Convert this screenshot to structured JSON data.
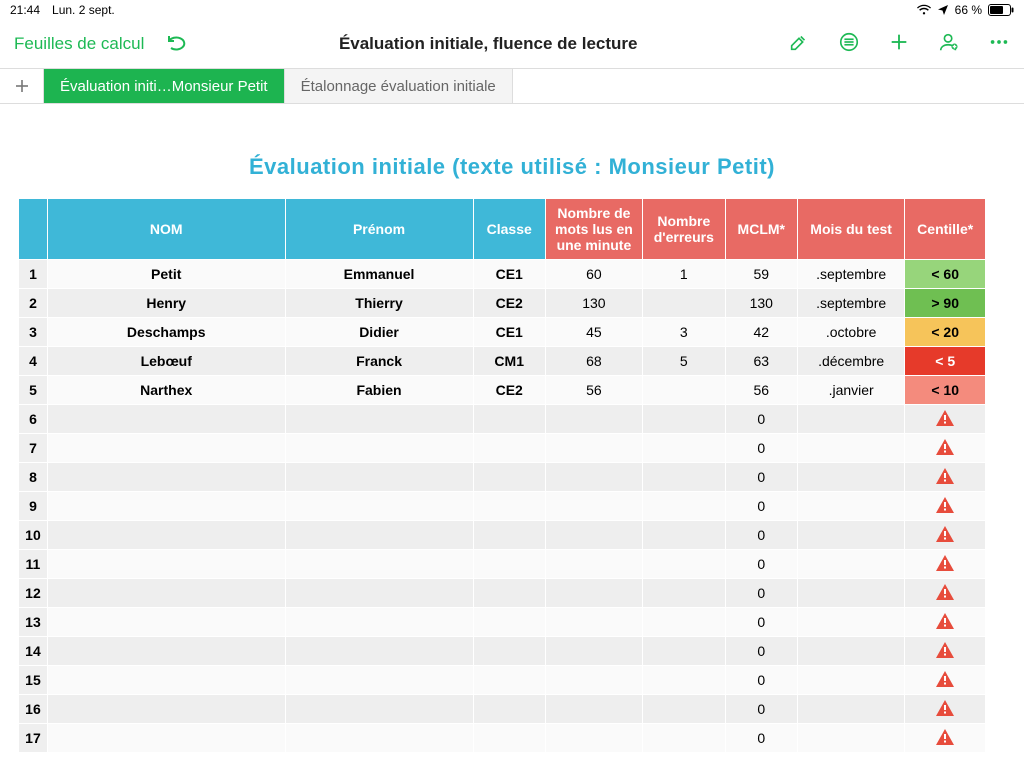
{
  "status": {
    "time": "21:44",
    "date": "Lun. 2 sept.",
    "battery": "66 %"
  },
  "toolbar": {
    "back": "Feuilles de calcul",
    "title": "Évaluation initiale, fluence de lecture"
  },
  "tabs": {
    "active": "Évaluation initi…Monsieur Petit",
    "inactive": "Étalonnage évaluation initiale"
  },
  "heading": "Évaluation initiale (texte utilisé : Monsieur Petit)",
  "columns": {
    "nom": "NOM",
    "prenom": "Prénom",
    "classe": "Classe",
    "mots": "Nombre de mots lus en une minute",
    "erreurs": "Nombre d'erreurs",
    "mclm": "MCLM*",
    "mois": "Mois du test",
    "centille": "Centille*"
  },
  "rows": [
    {
      "n": "1",
      "nom": "Petit",
      "prenom": "Emmanuel",
      "classe": "CE1",
      "mots": "60",
      "err": "1",
      "mclm": "59",
      "mois": ".septembre",
      "cent": "< 60",
      "centClass": "cent-green"
    },
    {
      "n": "2",
      "nom": "Henry",
      "prenom": "Thierry",
      "classe": "CE2",
      "mots": "130",
      "err": "",
      "mclm": "130",
      "mois": ".septembre",
      "cent": "> 90",
      "centClass": "cent-dgreen"
    },
    {
      "n": "3",
      "nom": "Deschamps",
      "prenom": "Didier",
      "classe": "CE1",
      "mots": "45",
      "err": "3",
      "mclm": "42",
      "mois": ".octobre",
      "cent": "< 20",
      "centClass": "cent-yellow"
    },
    {
      "n": "4",
      "nom": "Lebœuf",
      "prenom": "Franck",
      "classe": "CM1",
      "mots": "68",
      "err": "5",
      "mclm": "63",
      "mois": ".décembre",
      "cent": "< 5",
      "centClass": "cent-red"
    },
    {
      "n": "5",
      "nom": "Narthex",
      "prenom": "Fabien",
      "classe": "CE2",
      "mots": "56",
      "err": "",
      "mclm": "56",
      "mois": ".janvier",
      "cent": "< 10",
      "centClass": "cent-lred"
    },
    {
      "n": "6",
      "nom": "",
      "prenom": "",
      "classe": "",
      "mots": "",
      "err": "",
      "mclm": "0",
      "mois": "",
      "cent": "⚠",
      "centClass": "warn-cell"
    },
    {
      "n": "7",
      "nom": "",
      "prenom": "",
      "classe": "",
      "mots": "",
      "err": "",
      "mclm": "0",
      "mois": "",
      "cent": "⚠",
      "centClass": "warn-cell"
    },
    {
      "n": "8",
      "nom": "",
      "prenom": "",
      "classe": "",
      "mots": "",
      "err": "",
      "mclm": "0",
      "mois": "",
      "cent": "⚠",
      "centClass": "warn-cell"
    },
    {
      "n": "9",
      "nom": "",
      "prenom": "",
      "classe": "",
      "mots": "",
      "err": "",
      "mclm": "0",
      "mois": "",
      "cent": "⚠",
      "centClass": "warn-cell"
    },
    {
      "n": "10",
      "nom": "",
      "prenom": "",
      "classe": "",
      "mots": "",
      "err": "",
      "mclm": "0",
      "mois": "",
      "cent": "⚠",
      "centClass": "warn-cell"
    },
    {
      "n": "11",
      "nom": "",
      "prenom": "",
      "classe": "",
      "mots": "",
      "err": "",
      "mclm": "0",
      "mois": "",
      "cent": "⚠",
      "centClass": "warn-cell"
    },
    {
      "n": "12",
      "nom": "",
      "prenom": "",
      "classe": "",
      "mots": "",
      "err": "",
      "mclm": "0",
      "mois": "",
      "cent": "⚠",
      "centClass": "warn-cell"
    },
    {
      "n": "13",
      "nom": "",
      "prenom": "",
      "classe": "",
      "mots": "",
      "err": "",
      "mclm": "0",
      "mois": "",
      "cent": "⚠",
      "centClass": "warn-cell"
    },
    {
      "n": "14",
      "nom": "",
      "prenom": "",
      "classe": "",
      "mots": "",
      "err": "",
      "mclm": "0",
      "mois": "",
      "cent": "⚠",
      "centClass": "warn-cell"
    },
    {
      "n": "15",
      "nom": "",
      "prenom": "",
      "classe": "",
      "mots": "",
      "err": "",
      "mclm": "0",
      "mois": "",
      "cent": "⚠",
      "centClass": "warn-cell"
    },
    {
      "n": "16",
      "nom": "",
      "prenom": "",
      "classe": "",
      "mots": "",
      "err": "",
      "mclm": "0",
      "mois": "",
      "cent": "⚠",
      "centClass": "warn-cell"
    },
    {
      "n": "17",
      "nom": "",
      "prenom": "",
      "classe": "",
      "mots": "",
      "err": "",
      "mclm": "0",
      "mois": "",
      "cent": "⚠",
      "centClass": "warn-cell"
    }
  ]
}
